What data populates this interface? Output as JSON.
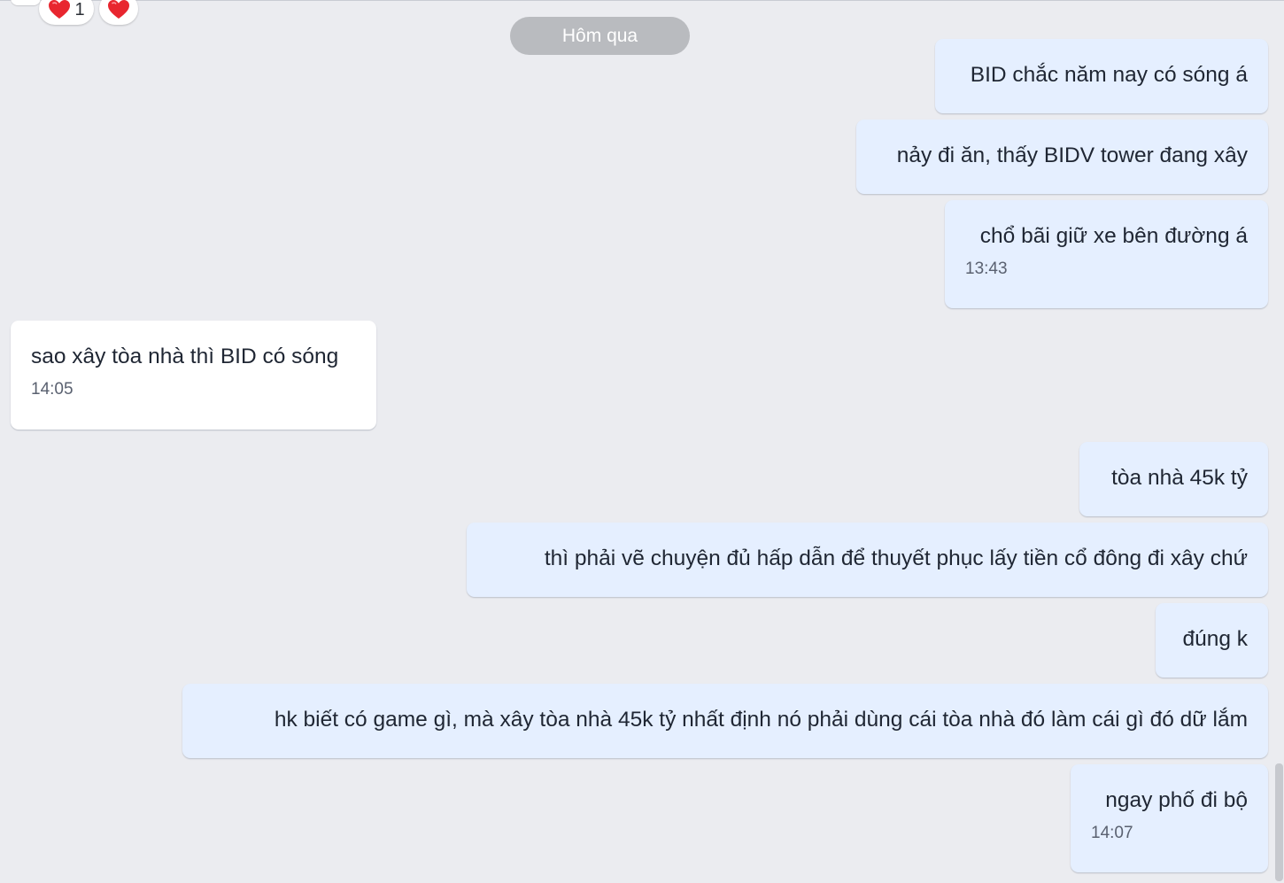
{
  "reactions": [
    {
      "icon": "heart-icon",
      "count": "1"
    },
    {
      "icon": "heart-icon",
      "count": ""
    }
  ],
  "date_separator": "Hôm qua",
  "messages": [
    {
      "direction": "outgoing",
      "text": "BID chắc năm nay có sóng á",
      "time": ""
    },
    {
      "direction": "outgoing",
      "text": "nảy đi ăn, thấy BIDV tower đang xây",
      "time": ""
    },
    {
      "direction": "outgoing",
      "text": "chổ bãi giữ xe bên đường á",
      "time": "13:43"
    },
    {
      "direction": "incoming",
      "text": "sao xây tòa nhà thì BID có sóng",
      "time": "14:05"
    },
    {
      "direction": "outgoing",
      "text": "tòa nhà 45k tỷ",
      "time": ""
    },
    {
      "direction": "outgoing",
      "text": "thì phải vẽ chuyện đủ hấp dẫn để thuyết phục lấy tiền cổ đông đi xây chứ",
      "time": ""
    },
    {
      "direction": "outgoing",
      "text": "đúng k",
      "time": ""
    },
    {
      "direction": "outgoing",
      "text": "hk biết có game gì, mà xây tòa nhà 45k tỷ nhất định nó phải dùng cái tòa nhà đó làm cái gì đó dữ lắm",
      "time": ""
    },
    {
      "direction": "outgoing",
      "text": "ngay phố đi bộ",
      "time": "14:07"
    }
  ],
  "colors": {
    "background": "#ebecf0",
    "outgoing_bubble": "#e5efff",
    "incoming_bubble": "#ffffff",
    "date_pill": "#b9bbbf",
    "heart": "#e8262f"
  }
}
